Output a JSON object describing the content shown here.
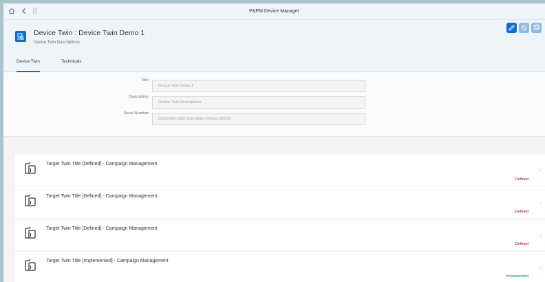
{
  "shell": {
    "title": "P&PM Device Manager",
    "home_icon": "home-icon",
    "back_icon": "back-icon",
    "menu_icon": "menu-icon"
  },
  "header": {
    "title": "Device Twin : Device Twin Demo 1",
    "subtitle": "Device Twin Descriptions",
    "object_icon": "device-icon",
    "actions": [
      "edit-icon",
      "cancel-icon",
      "copy-icon"
    ]
  },
  "tabs": [
    {
      "label": "Device Twin",
      "active": true
    },
    {
      "label": "Technicals",
      "active": false
    }
  ],
  "form": {
    "title_label": "Title:",
    "title_value": "Device Twin Demo 1",
    "description_label": "Description:",
    "description_value": "Device Twin Descriptions",
    "serial_label": "Serial Number:",
    "serial_value": "bd216430-c9b0-11eb-b8bc-0242ac130003"
  },
  "targets": [
    {
      "title": "Target Twin Title [Defined] - Campaign Management",
      "status": "Defined",
      "status_color": "#bb0000"
    },
    {
      "title": "Target Twin Title [Defined] - Campaign Management",
      "status": "Defined",
      "status_color": "#bb0000"
    },
    {
      "title": "Target Twin Title [Defined] - Campaign Management",
      "status": "Defined",
      "status_color": "#bb0000"
    },
    {
      "title": "Target Twin Title [Implemented] - Campaign Management",
      "status": "Implemented",
      "status_color": "#107e3e"
    }
  ],
  "colors": {
    "accent": "#0a6ed1",
    "button_disabled": "#8fb7e3"
  }
}
